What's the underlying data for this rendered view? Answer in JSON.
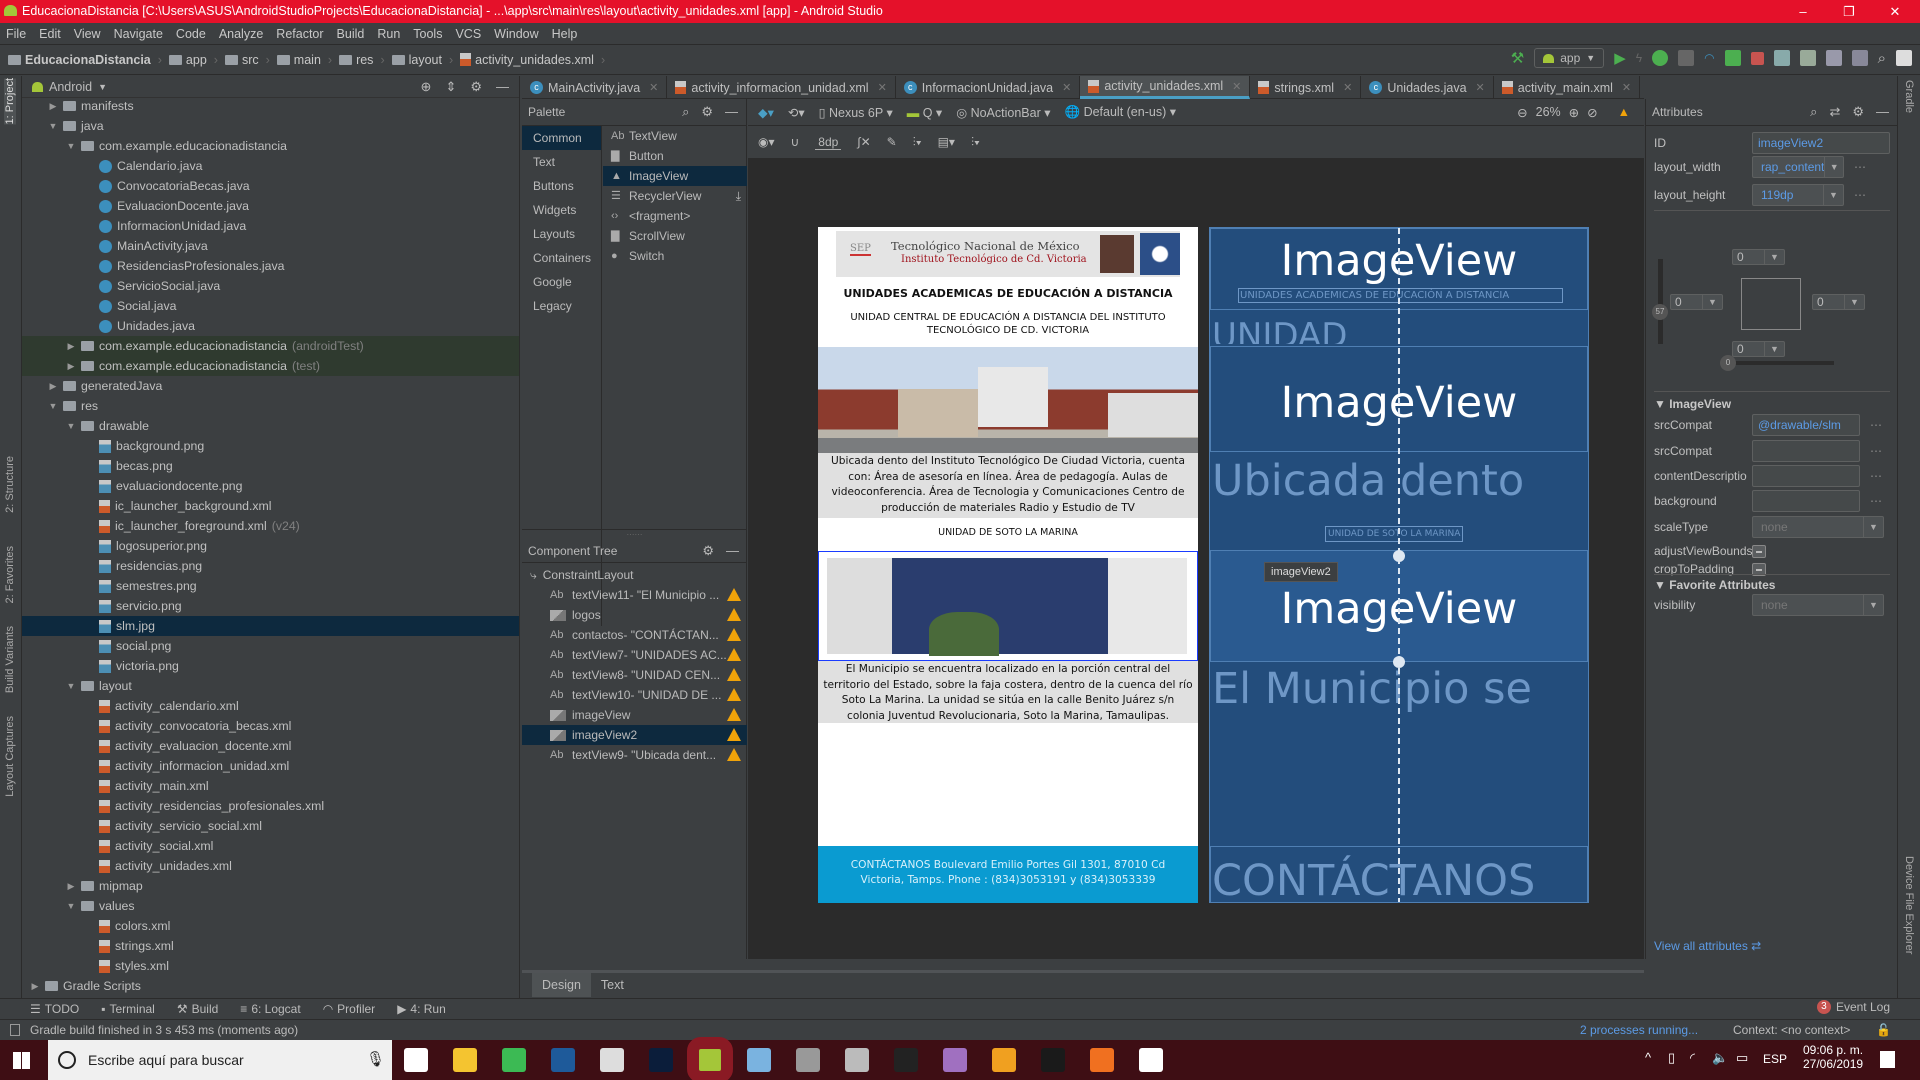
{
  "window": {
    "title": "EducacionaDistancia [C:\\Users\\ASUS\\AndroidStudioProjects\\EducacionaDistancia] - ...\\app\\src\\main\\res\\layout\\activity_unidades.xml [app] - Android Studio",
    "minimize": "–",
    "maximize": "❐",
    "close": "✕",
    "accent": "#e5112a"
  },
  "menu": [
    "File",
    "Edit",
    "View",
    "Navigate",
    "Code",
    "Analyze",
    "Refactor",
    "Build",
    "Run",
    "Tools",
    "VCS",
    "Window",
    "Help"
  ],
  "breadcrumb": [
    "EducacionaDistancia",
    "app",
    "src",
    "main",
    "res",
    "layout",
    "activity_unidades.xml"
  ],
  "run_config": "app",
  "left_strip": [
    "1: Project",
    "2: Structure",
    "2: Favorites",
    "Build Variants",
    "Layout Captures"
  ],
  "right_strip": [
    "Gradle",
    "Device File Explorer"
  ],
  "project": {
    "view": "Android",
    "tree": [
      {
        "label": "manifests",
        "level": 1,
        "type": "folder",
        "state": "closed"
      },
      {
        "label": "java",
        "level": 1,
        "type": "folder",
        "state": "open"
      },
      {
        "label": "com.example.educacionadistancia",
        "level": 2,
        "type": "folder",
        "state": "open"
      },
      {
        "label": "Calendario.java",
        "level": 3,
        "type": "class"
      },
      {
        "label": "ConvocatoriaBecas.java",
        "level": 3,
        "type": "class"
      },
      {
        "label": "EvaluacionDocente.java",
        "level": 3,
        "type": "class"
      },
      {
        "label": "InformacionUnidad.java",
        "level": 3,
        "type": "class"
      },
      {
        "label": "MainActivity.java",
        "level": 3,
        "type": "class"
      },
      {
        "label": "ResidenciasProfesionales.java",
        "level": 3,
        "type": "class"
      },
      {
        "label": "ServicioSocial.java",
        "level": 3,
        "type": "class"
      },
      {
        "label": "Social.java",
        "level": 3,
        "type": "class"
      },
      {
        "label": "Unidades.java",
        "level": 3,
        "type": "class"
      },
      {
        "label": "com.example.educacionadistancia",
        "suffix": "(androidTest)",
        "level": 2,
        "type": "folder",
        "state": "closed",
        "test": true
      },
      {
        "label": "com.example.educacionadistancia",
        "suffix": "(test)",
        "level": 2,
        "type": "folder",
        "state": "closed",
        "test": true
      },
      {
        "label": "generatedJava",
        "level": 1,
        "type": "folder",
        "state": "closed"
      },
      {
        "label": "res",
        "level": 1,
        "type": "folder",
        "state": "open"
      },
      {
        "label": "drawable",
        "level": 2,
        "type": "folder",
        "state": "open"
      },
      {
        "label": "background.png",
        "level": 3,
        "type": "image"
      },
      {
        "label": "becas.png",
        "level": 3,
        "type": "image"
      },
      {
        "label": "evaluaciondocente.png",
        "level": 3,
        "type": "image"
      },
      {
        "label": "ic_launcher_background.xml",
        "level": 3,
        "type": "xml"
      },
      {
        "label": "ic_launcher_foreground.xml",
        "suffix": "(v24)",
        "level": 3,
        "type": "xml"
      },
      {
        "label": "logosuperior.png",
        "level": 3,
        "type": "image"
      },
      {
        "label": "residencias.png",
        "level": 3,
        "type": "image"
      },
      {
        "label": "semestres.png",
        "level": 3,
        "type": "image"
      },
      {
        "label": "servicio.png",
        "level": 3,
        "type": "image"
      },
      {
        "label": "slm.jpg",
        "level": 3,
        "type": "image",
        "selected": true
      },
      {
        "label": "social.png",
        "level": 3,
        "type": "image"
      },
      {
        "label": "victoria.png",
        "level": 3,
        "type": "image"
      },
      {
        "label": "layout",
        "level": 2,
        "type": "folder",
        "state": "open"
      },
      {
        "label": "activity_calendario.xml",
        "level": 3,
        "type": "xml"
      },
      {
        "label": "activity_convocatoria_becas.xml",
        "level": 3,
        "type": "xml"
      },
      {
        "label": "activity_evaluacion_docente.xml",
        "level": 3,
        "type": "xml"
      },
      {
        "label": "activity_informacion_unidad.xml",
        "level": 3,
        "type": "xml"
      },
      {
        "label": "activity_main.xml",
        "level": 3,
        "type": "xml"
      },
      {
        "label": "activity_residencias_profesionales.xml",
        "level": 3,
        "type": "xml"
      },
      {
        "label": "activity_servicio_social.xml",
        "level": 3,
        "type": "xml"
      },
      {
        "label": "activity_social.xml",
        "level": 3,
        "type": "xml"
      },
      {
        "label": "activity_unidades.xml",
        "level": 3,
        "type": "xml"
      },
      {
        "label": "mipmap",
        "level": 2,
        "type": "folder",
        "state": "closed"
      },
      {
        "label": "values",
        "level": 2,
        "type": "folder",
        "state": "open"
      },
      {
        "label": "colors.xml",
        "level": 3,
        "type": "xml"
      },
      {
        "label": "strings.xml",
        "level": 3,
        "type": "xml"
      },
      {
        "label": "styles.xml",
        "level": 3,
        "type": "xml"
      },
      {
        "label": "Gradle Scripts",
        "level": 0,
        "type": "gradle",
        "state": "closed"
      }
    ]
  },
  "editor_tabs": [
    {
      "label": "MainActivity.java",
      "type": "class"
    },
    {
      "label": "activity_informacion_unidad.xml",
      "type": "xml"
    },
    {
      "label": "InformacionUnidad.java",
      "type": "class"
    },
    {
      "label": "activity_unidades.xml",
      "type": "xml",
      "active": true
    },
    {
      "label": "strings.xml",
      "type": "xml"
    },
    {
      "label": "Unidades.java",
      "type": "class"
    },
    {
      "label": "activity_main.xml",
      "type": "xml"
    }
  ],
  "palette": {
    "title": "Palette",
    "categories": [
      "Common",
      "Text",
      "Buttons",
      "Widgets",
      "Layouts",
      "Containers",
      "Google",
      "Legacy"
    ],
    "selected_category": "Common",
    "items": [
      {
        "icon": "Ab",
        "label": "TextView"
      },
      {
        "icon": "▇",
        "label": "Button"
      },
      {
        "icon": "▲",
        "label": "ImageView",
        "selected": true
      },
      {
        "icon": "☰",
        "label": "RecyclerView",
        "download": true
      },
      {
        "icon": "‹›",
        "label": "<fragment>"
      },
      {
        "icon": "▇",
        "label": "ScrollView"
      },
      {
        "icon": "●",
        "label": "Switch"
      }
    ]
  },
  "component_tree": {
    "title": "Component Tree",
    "root": "ConstraintLayout",
    "items": [
      {
        "icon": "Ab",
        "label": "textView11- \"El Municipio ..."
      },
      {
        "icon": "img",
        "label": "logos"
      },
      {
        "icon": "Ab",
        "label": "contactos- \"CONTÁCTAN..."
      },
      {
        "icon": "Ab",
        "label": "textView7- \"UNIDADES AC..."
      },
      {
        "icon": "Ab",
        "label": "textView8- \"UNIDAD CEN..."
      },
      {
        "icon": "Ab",
        "label": "textView10- \"UNIDAD DE ..."
      },
      {
        "icon": "img",
        "label": "imageView"
      },
      {
        "icon": "img",
        "label": "imageView2",
        "selected": true
      },
      {
        "icon": "Ab",
        "label": "textView9- \"Ubicada dent..."
      }
    ]
  },
  "design_toolbar": {
    "device": "Nexus 6P",
    "api": "Q",
    "theme": "NoActionBar",
    "locale": "Default (en-us)",
    "zoom": "26%",
    "margin": "8dp"
  },
  "preview": {
    "logo_title": "Tecnológico Nacional de México",
    "logo_subtitle": "Instituto Tecnológico de Cd. Victoria",
    "logo_sep": "SEP",
    "heading": "UNIDADES ACADEMICAS DE EDUCACIÓN A DISTANCIA",
    "subheading": "UNIDAD CENTRAL DE EDUCACIÓN A DISTANCIA DEL INSTITUTO TECNOLÓGICO DE CD. VICTORIA",
    "description1": "Ubicada dento del Instituto Tecnológico De Ciudad Victoria, cuenta con: Área de asesoría en línea. Área de pedagogía. Aulas de videoconferencia. Área de Tecnologia y Comunicaciones Centro de producción de materiales Radio y Estudio de TV",
    "unit2_title": "UNIDAD DE SOTO LA MARINA",
    "description2": "El Municipio se encuentra localizado en la porción central del territorio del Estado, sobre la faja costera, dentro de la cuenca del río Soto La Marina. La unidad se sitúa en la calle Benito Juárez s/n colonia Juventud Revolucionaria, Soto la Marina, Tamaulipas.",
    "contact": "CONTÁCTANOS Boulevard Emilio Portes Gil 1301, 87010 Cd Victoria, Tamps.  Phone : (834)3053191 y (834)3053339",
    "contact_color": "#0a9bd1"
  },
  "blueprint": {
    "imageview": "ImageView",
    "heading": "UNIDADES ACADEMICAS DE EDUCACIÓN A DISTANCIA",
    "unidad": "UNIDAD",
    "ubicada": "Ubicada dento",
    "soto": "UNIDAD DE SOTO LA MARINA",
    "municipio": "El Municipio se",
    "contact": "CONTÁCTANOS",
    "tooltip": "imageView2"
  },
  "attributes": {
    "title": "Attributes",
    "id_label": "ID",
    "id": "imageView2",
    "layout_width_label": "layout_width",
    "layout_width": "rap_content",
    "layout_height_label": "layout_height",
    "layout_height": "119dp",
    "margins": {
      "top": "0",
      "left": "0",
      "right": "0",
      "bottom": "0"
    },
    "vertical_bias": "57",
    "horizontal_bias": "0",
    "imageview_section": "ImageView",
    "srcCompat_label": "srcCompat",
    "srcCompat": "@drawable/slm",
    "srcCompat_tools_label": "srcCompat",
    "contentDescription_label": "contentDescriptio",
    "background_label": "background",
    "scaleType_label": "scaleType",
    "scaleType": "none",
    "adjustViewBounds_label": "adjustViewBounds",
    "cropToPadding_label": "cropToPadding",
    "favorite_section": "Favorite Attributes",
    "visibility_label": "visibility",
    "visibility": "none",
    "view_all": "View all attributes"
  },
  "design_tabs": [
    {
      "label": "Design",
      "active": true
    },
    {
      "label": "Text"
    }
  ],
  "bottom_tools": [
    "TODO",
    "Terminal",
    "Build",
    "6: Logcat",
    "Profiler",
    "4: Run"
  ],
  "event_log": {
    "count": "3",
    "label": "Event Log"
  },
  "status": {
    "message": "Gradle build finished in 3 s 453 ms (moments ago)",
    "processes": "2 processes running...",
    "context": "Context: <no context>"
  },
  "taskbar": {
    "search_placeholder": "Escribe aquí para buscar",
    "lang": "ESP",
    "time": "09:06 p. m.",
    "date": "27/06/2019",
    "apps": [
      "task-view",
      "file-explorer",
      "chrome",
      "teamviewer",
      "app-5",
      "photoshop",
      "android-studio",
      "virtualbox",
      "app-9",
      "app-10",
      "obs",
      "app-12",
      "app-13",
      "movie-maker",
      "xampp",
      "photos"
    ]
  }
}
